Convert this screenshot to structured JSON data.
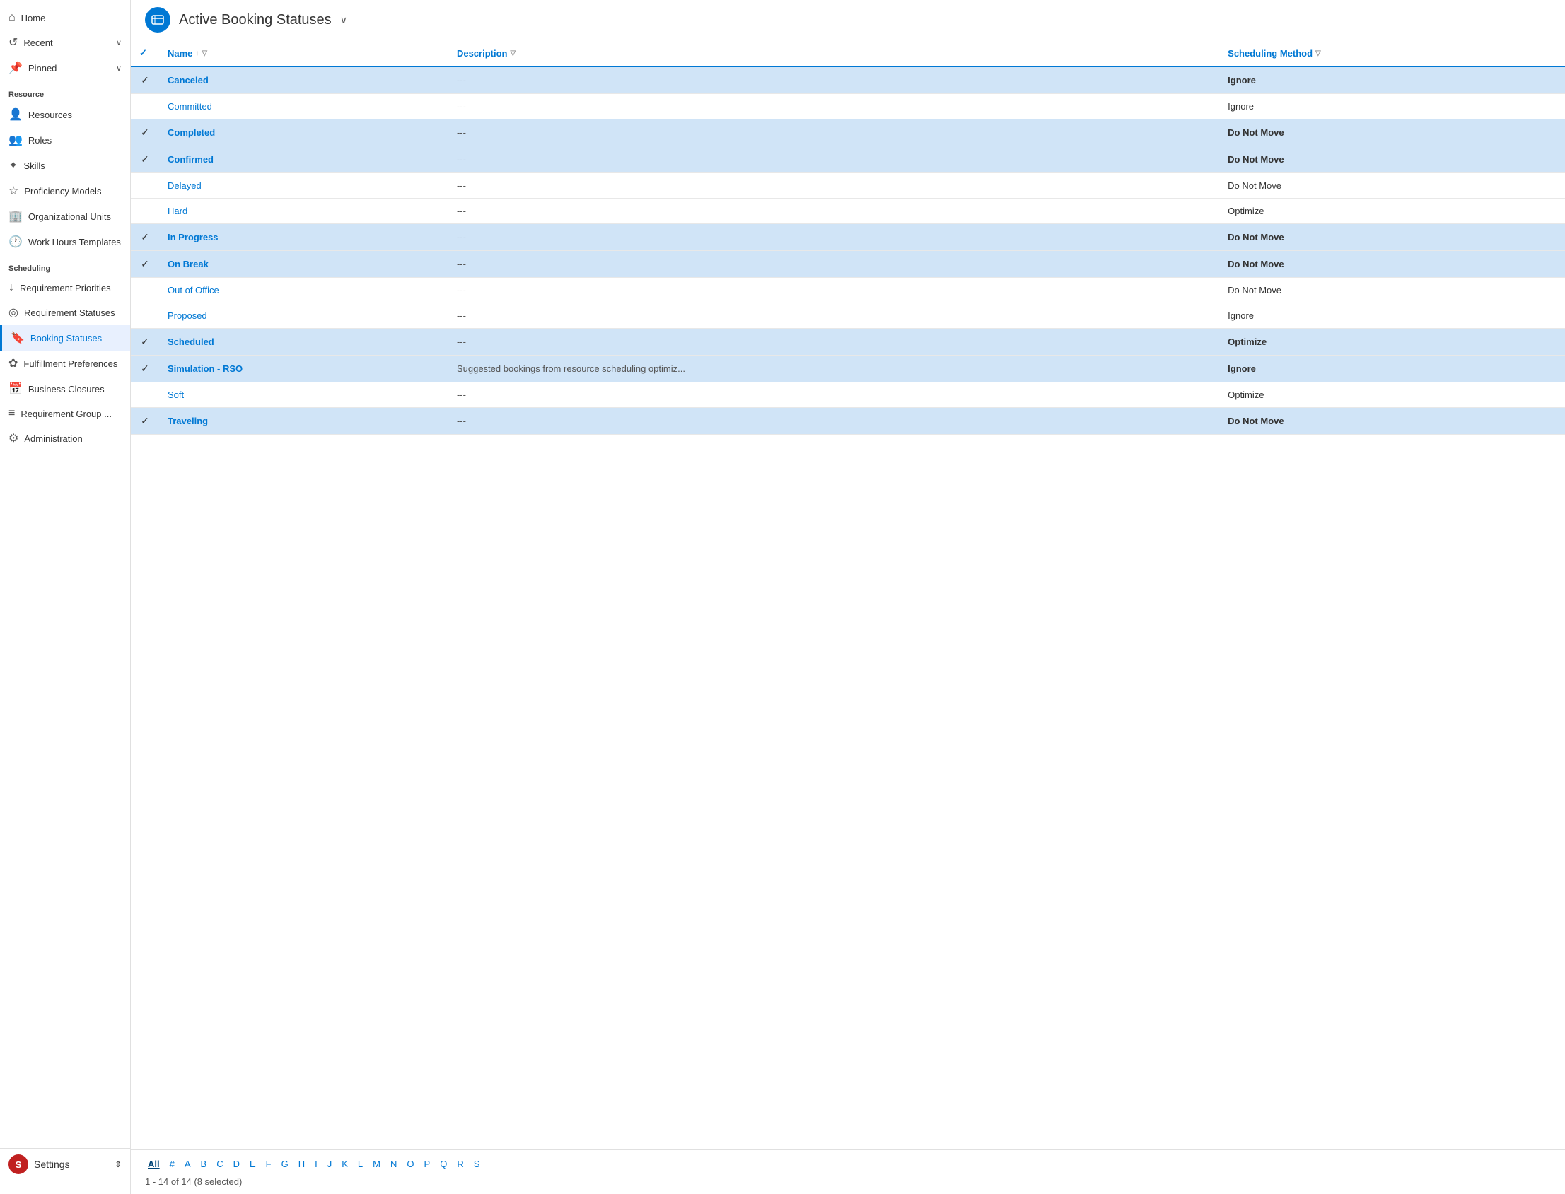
{
  "sidebar": {
    "nav_top": [
      {
        "id": "home",
        "label": "Home",
        "icon": "⌂"
      },
      {
        "id": "recent",
        "label": "Recent",
        "icon": "↺",
        "hasChevron": true
      },
      {
        "id": "pinned",
        "label": "Pinned",
        "icon": "📌",
        "hasChevron": true
      }
    ],
    "sections": [
      {
        "header": "Resource",
        "items": [
          {
            "id": "resources",
            "label": "Resources",
            "icon": "👤"
          },
          {
            "id": "roles",
            "label": "Roles",
            "icon": "👥"
          },
          {
            "id": "skills",
            "label": "Skills",
            "icon": "✦"
          },
          {
            "id": "proficiency-models",
            "label": "Proficiency Models",
            "icon": "☆"
          },
          {
            "id": "organizational-units",
            "label": "Organizational Units",
            "icon": "🏢"
          },
          {
            "id": "work-hours-templates",
            "label": "Work Hours Templates",
            "icon": "🕐"
          }
        ]
      },
      {
        "header": "Scheduling",
        "items": [
          {
            "id": "requirement-priorities",
            "label": "Requirement Priorities",
            "icon": "↓"
          },
          {
            "id": "requirement-statuses",
            "label": "Requirement Statuses",
            "icon": "◎"
          },
          {
            "id": "booking-statuses",
            "label": "Booking Statuses",
            "icon": "🔖",
            "active": true
          },
          {
            "id": "fulfillment-preferences",
            "label": "Fulfillment Preferences",
            "icon": "✿"
          },
          {
            "id": "business-closures",
            "label": "Business Closures",
            "icon": "📅"
          },
          {
            "id": "requirement-group",
            "label": "Requirement Group ...",
            "icon": "≡"
          },
          {
            "id": "administration",
            "label": "Administration",
            "icon": "⚙"
          }
        ]
      }
    ],
    "bottom": {
      "avatar_letter": "S",
      "label": "Settings",
      "icon": "⇕"
    }
  },
  "header": {
    "icon_letter": "B",
    "title": "Active Booking Statuses",
    "chevron": "∨"
  },
  "table": {
    "columns": [
      {
        "id": "check",
        "label": ""
      },
      {
        "id": "name",
        "label": "Name",
        "sortable": true,
        "filterable": true
      },
      {
        "id": "description",
        "label": "Description",
        "filterable": true
      },
      {
        "id": "scheduling_method",
        "label": "Scheduling Method",
        "filterable": true
      }
    ],
    "rows": [
      {
        "id": 1,
        "selected": true,
        "name": "Canceled",
        "description": "---",
        "scheduling_method": "Ignore"
      },
      {
        "id": 2,
        "selected": false,
        "name": "Committed",
        "description": "---",
        "scheduling_method": "Ignore"
      },
      {
        "id": 3,
        "selected": true,
        "name": "Completed",
        "description": "---",
        "scheduling_method": "Do Not Move"
      },
      {
        "id": 4,
        "selected": true,
        "name": "Confirmed",
        "description": "---",
        "scheduling_method": "Do Not Move"
      },
      {
        "id": 5,
        "selected": false,
        "name": "Delayed",
        "description": "---",
        "scheduling_method": "Do Not Move"
      },
      {
        "id": 6,
        "selected": false,
        "name": "Hard",
        "description": "---",
        "scheduling_method": "Optimize"
      },
      {
        "id": 7,
        "selected": true,
        "name": "In Progress",
        "description": "---",
        "scheduling_method": "Do Not Move"
      },
      {
        "id": 8,
        "selected": true,
        "name": "On Break",
        "description": "---",
        "scheduling_method": "Do Not Move"
      },
      {
        "id": 9,
        "selected": false,
        "name": "Out of Office",
        "description": "---",
        "scheduling_method": "Do Not Move"
      },
      {
        "id": 10,
        "selected": false,
        "name": "Proposed",
        "description": "---",
        "scheduling_method": "Ignore"
      },
      {
        "id": 11,
        "selected": true,
        "name": "Scheduled",
        "description": "---",
        "scheduling_method": "Optimize"
      },
      {
        "id": 12,
        "selected": true,
        "name": "Simulation - RSO",
        "description": "Suggested bookings from resource scheduling optimiz...",
        "scheduling_method": "Ignore"
      },
      {
        "id": 13,
        "selected": false,
        "name": "Soft",
        "description": "---",
        "scheduling_method": "Optimize"
      },
      {
        "id": 14,
        "selected": true,
        "name": "Traveling",
        "description": "---",
        "scheduling_method": "Do Not Move"
      }
    ]
  },
  "footer": {
    "alphabet": [
      "All",
      "#",
      "A",
      "B",
      "C",
      "D",
      "E",
      "F",
      "G",
      "H",
      "I",
      "J",
      "K",
      "L",
      "M",
      "N",
      "O",
      "P",
      "Q",
      "R",
      "S"
    ],
    "active_alpha": "All",
    "page_info": "1 - 14 of 14 (8 selected)"
  }
}
